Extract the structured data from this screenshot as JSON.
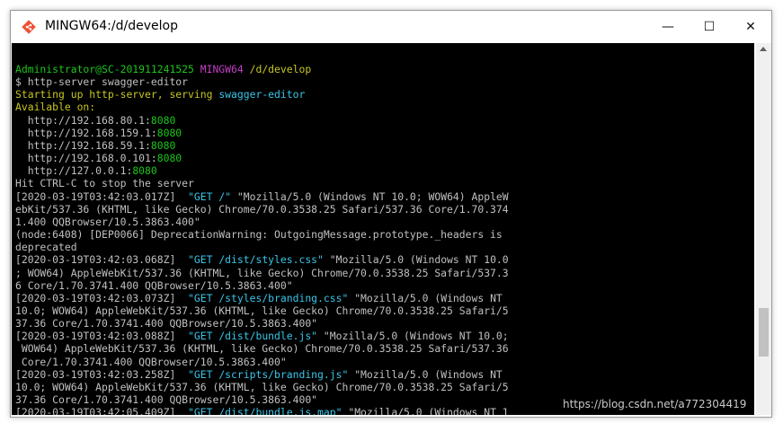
{
  "window": {
    "title": "MINGW64:/d/develop"
  },
  "prompt": {
    "user": "Administrator@SC-201911241525",
    "system": "MINGW64",
    "path": "/d/develop"
  },
  "command": "$ http-server swagger-editor",
  "starting": {
    "text": "Starting up http-server, serving ",
    "dir": "swagger-editor"
  },
  "available_label": "Available on:",
  "addresses": [
    {
      "url": "  http://192.168.80.1:",
      "port": "8080"
    },
    {
      "url": "  http://192.168.159.1:",
      "port": "8080"
    },
    {
      "url": "  http://192.168.59.1:",
      "port": "8080"
    },
    {
      "url": "  http://192.168.0.101:",
      "port": "8080"
    },
    {
      "url": "  http://127.0.0.1:",
      "port": "8080"
    }
  ],
  "stop_hint": "Hit CTRL-C to stop the server",
  "logs": [
    {
      "ts": "[2020-03-19T03:42:03.017Z]  ",
      "req": "\"GET /\"",
      "ua1": " \"Mozilla/5.0 (Windows NT 10.0; WOW64) AppleW",
      "ua2": "ebKit/537.36 (KHTML, like Gecko) Chrome/70.0.3538.25 Safari/537.36 Core/1.70.374",
      "ua3": "1.400 QQBrowser/10.5.3863.400\""
    },
    {
      "ts": "[2020-03-19T03:42:03.068Z]  ",
      "req": "\"GET /dist/styles.css\"",
      "ua1": " \"Mozilla/5.0 (Windows NT 10.0",
      "ua2": "; WOW64) AppleWebKit/537.36 (KHTML, like Gecko) Chrome/70.0.3538.25 Safari/537.3",
      "ua3": "6 Core/1.70.3741.400 QQBrowser/10.5.3863.400\""
    },
    {
      "ts": "[2020-03-19T03:42:03.073Z]  ",
      "req": "\"GET /styles/branding.css\"",
      "ua1": " \"Mozilla/5.0 (Windows NT",
      "ua2": "10.0; WOW64) AppleWebKit/537.36 (KHTML, like Gecko) Chrome/70.0.3538.25 Safari/5",
      "ua3": "37.36 Core/1.70.3741.400 QQBrowser/10.5.3863.400\""
    },
    {
      "ts": "[2020-03-19T03:42:03.088Z]  ",
      "req": "\"GET /dist/bundle.js\"",
      "ua1": " \"Mozilla/5.0 (Windows NT 10.0;",
      "ua2": " WOW64) AppleWebKit/537.36 (KHTML, like Gecko) Chrome/70.0.3538.25 Safari/537.36",
      "ua3": " Core/1.70.3741.400 QQBrowser/10.5.3863.400\""
    },
    {
      "ts": "[2020-03-19T03:42:03.258Z]  ",
      "req": "\"GET /scripts/branding.js\"",
      "ua1": " \"Mozilla/5.0 (Windows NT",
      "ua2": "10.0; WOW64) AppleWebKit/537.36 (KHTML, like Gecko) Chrome/70.0.3538.25 Safari/5",
      "ua3": "37.36 Core/1.70.3741.400 QQBrowser/10.5.3863.400\""
    },
    {
      "ts": "[2020-03-19T03:42:05.409Z]  ",
      "req": "\"GET /dist/bundle.js.map\"",
      "ua1": " \"Mozilla/5.0 (Windows NT 1",
      "ua2": "",
      "ua3": ""
    }
  ],
  "deprecation": {
    "line1": "(node:6408) [DEP0066] DeprecationWarning: OutgoingMessage.prototype._headers is",
    "line2": "deprecated"
  },
  "watermark": "https://blog.csdn.net/a772304419",
  "colors": {
    "terminal_bg": "#000000",
    "green": "#1cc51c",
    "magenta": "#c33fc3",
    "yellow": "#c6c621",
    "cyan": "#39c5e8"
  }
}
